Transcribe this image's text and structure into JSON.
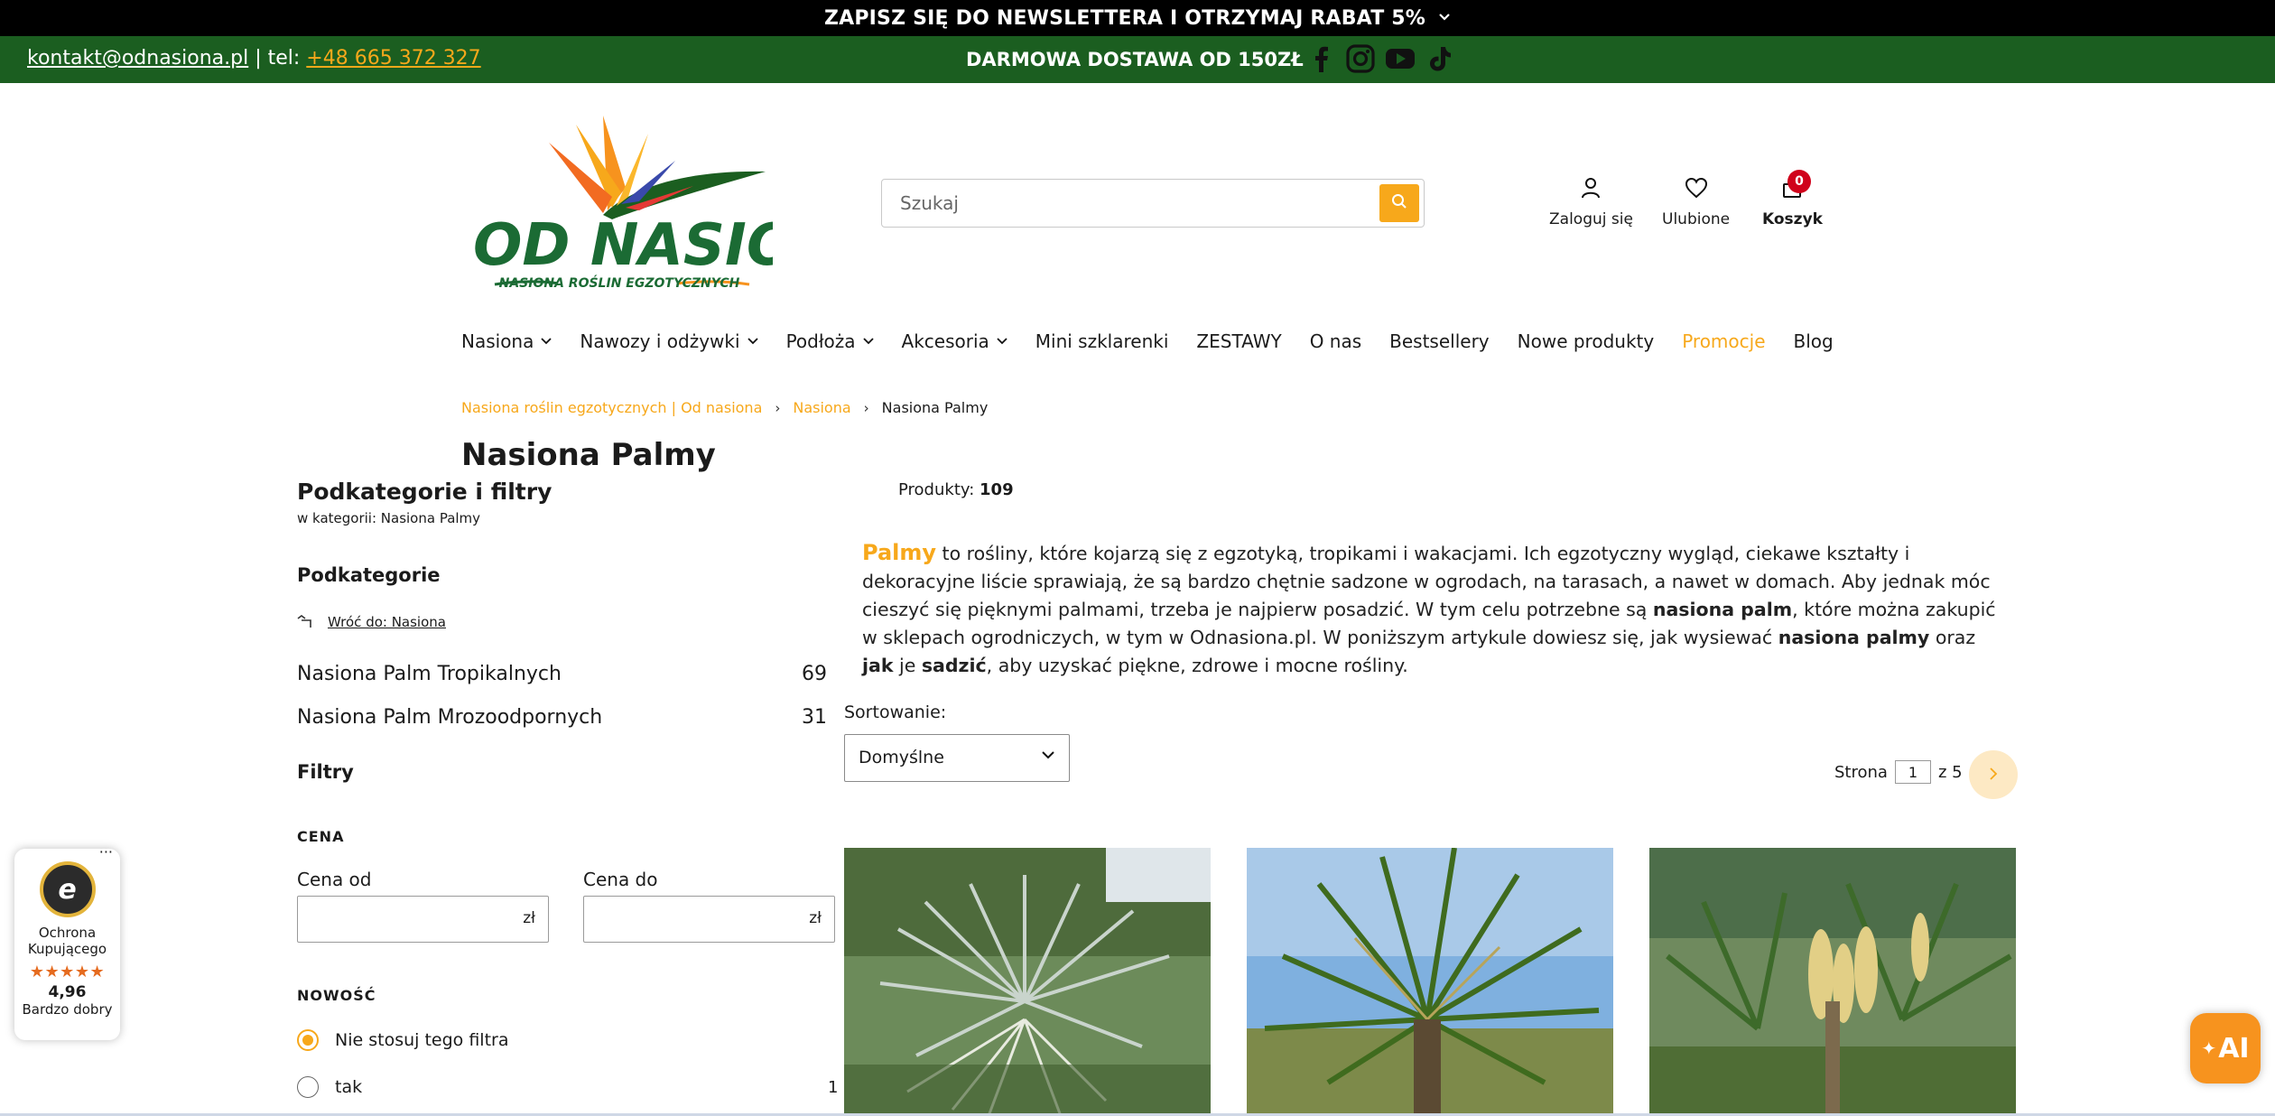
{
  "topbar": {
    "text": "ZAPISZ SIĘ DO NEWSLETTERA I OTRZYMAJ RABAT 5%"
  },
  "contact": {
    "email": "kontakt@odnasiona.pl",
    "sep": " | tel: ",
    "phone": "+48 665 372 327"
  },
  "shipping": "DARMOWA DOSTAWA OD 150ZŁ",
  "socials": [
    "facebook-icon",
    "instagram-icon",
    "youtube-icon",
    "tiktok-icon"
  ],
  "logo": {
    "name": "OD NASIONA",
    "tagline": "NASIONA ROŚLIN EGZOTYCZNYCH"
  },
  "search": {
    "placeholder": "Szukaj"
  },
  "header": {
    "login": "Zaloguj się",
    "favorites": "Ulubione",
    "cart": "Koszyk",
    "cart_count": "0"
  },
  "nav": [
    {
      "label": "Nasiona",
      "dropdown": true
    },
    {
      "label": "Nawozy i odżywki",
      "dropdown": true
    },
    {
      "label": "Podłoża",
      "dropdown": true
    },
    {
      "label": "Akcesoria",
      "dropdown": true
    },
    {
      "label": "Mini szklarenki"
    },
    {
      "label": "ZESTAWY"
    },
    {
      "label": "O nas"
    },
    {
      "label": "Bestsellery"
    },
    {
      "label": "Nowe produkty"
    },
    {
      "label": "Promocje"
    },
    {
      "label": "Blog"
    }
  ],
  "breadcrumb": [
    "Nasiona roślin egzotycznych | Od nasiona",
    "Nasiona",
    "Nasiona Palmy"
  ],
  "page_title": "Nasiona Palmy",
  "sidebar": {
    "title": "Podkategorie i filtry",
    "subtitle": "w kategorii: Nasiona Palmy",
    "subcategories_heading": "Podkategorie",
    "back_link": "Wróć do: Nasiona",
    "subcategories": [
      {
        "name": "Nasiona Palm Tropikalnych",
        "count": "69"
      },
      {
        "name": "Nasiona Palm Mrozoodpornych",
        "count": "31"
      }
    ],
    "filters_heading": "Filtry",
    "price": {
      "heading": "CENA",
      "from_label": "Cena od",
      "to_label": "Cena do",
      "currency": "zł"
    },
    "novelty": {
      "heading": "NOWOŚĆ",
      "opt1": "Nie stosuj tego filtra",
      "opt2": "tak",
      "opt2_count": "1"
    }
  },
  "products_label": "Produkty:",
  "products_count": "109",
  "description": {
    "highlight": "Palmy",
    "p1": " to rośliny, które kojarzą się z egzotyką, tropikami i wakacjami. Ich egzotyczny wygląd, ciekawe kształty i dekoracyjne liście sprawiają, że są bardzo chętnie sadzone w ogrodach, na tarasach, a nawet w domach. Aby jednak móc cieszyć się pięknymi palmami, trzeba je najpierw posadzić. W tym celu potrzebne są ",
    "b1": "nasiona palm",
    "p2": ", które można zakupić w sklepach ogrodniczych, w tym w Odnasiona.pl. W poniższym artykule dowiesz się, jak wysiewać ",
    "b2": "nasiona palmy",
    "p3": " oraz ",
    "b3": "jak",
    "p4": " je ",
    "b4": "sadzić",
    "p5": ", aby uzyskać piękne, zdrowe i mocne rośliny."
  },
  "sorting": {
    "label": "Sortowanie:",
    "value": "Domyślne"
  },
  "pager": {
    "label": "Strona",
    "page": "1",
    "of": "z 5"
  },
  "trusted": {
    "line1": "Ochrona",
    "line2": "Kupującego",
    "stars": "★★★★★",
    "score": "4,96",
    "rating": "Bardzo dobry"
  },
  "ai_button": "AI",
  "colors": {
    "accent": "#f7a81b",
    "green": "#1b5e20",
    "black": "#000000"
  }
}
